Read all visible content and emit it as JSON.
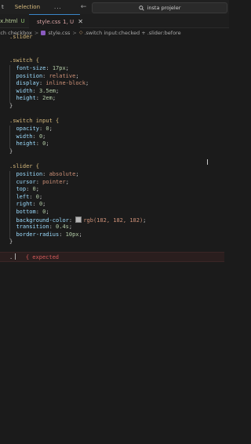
{
  "menu": {
    "items": [
      "t",
      "Selection"
    ],
    "more": "..."
  },
  "nav": {
    "back": "←",
    "forward": "→"
  },
  "search": {
    "text": "insta projeler"
  },
  "tabs": [
    {
      "label": "ex.html",
      "status": "U"
    },
    {
      "label": "style.css",
      "status": "1, U",
      "close": "✕"
    }
  ],
  "breadcrumb": {
    "parts": [
      "itch checkbox",
      "style.css",
      ".switch input:checked + .slider:before"
    ],
    "sep": ">"
  },
  "code": {
    "top_partial": ".slider",
    "switch_block": {
      "selector": ".switch {",
      "decls": [
        [
          "font-size",
          "17px"
        ],
        [
          "position",
          "relative"
        ],
        [
          "display",
          "inline-block"
        ],
        [
          "width",
          "3.5em"
        ],
        [
          "height",
          "2em"
        ]
      ],
      "close": "}"
    },
    "switch_input_block": {
      "selector": ".switch input {",
      "decls": [
        [
          "opacity",
          "0"
        ],
        [
          "width",
          "0"
        ],
        [
          "height",
          "0"
        ]
      ],
      "close": "}"
    },
    "slider_block": {
      "selector": ".slider {",
      "decls": [
        [
          "position",
          "absolute"
        ],
        [
          "cursor",
          "pointer"
        ],
        [
          "top",
          "0"
        ],
        [
          "left",
          "0"
        ],
        [
          "right",
          "0"
        ],
        [
          "bottom",
          "0"
        ],
        [
          "background-color",
          "rgb(182, 182, 182)"
        ],
        [
          "transition",
          "0.4s"
        ],
        [
          "border-radius",
          "10px"
        ]
      ],
      "close": "}"
    },
    "error_line": {
      "text": ".",
      "message": "{ expected"
    }
  },
  "colors": {
    "swatch": "#b6b6b6",
    "accent": "#3a86c8",
    "error": "#d65a5a"
  }
}
